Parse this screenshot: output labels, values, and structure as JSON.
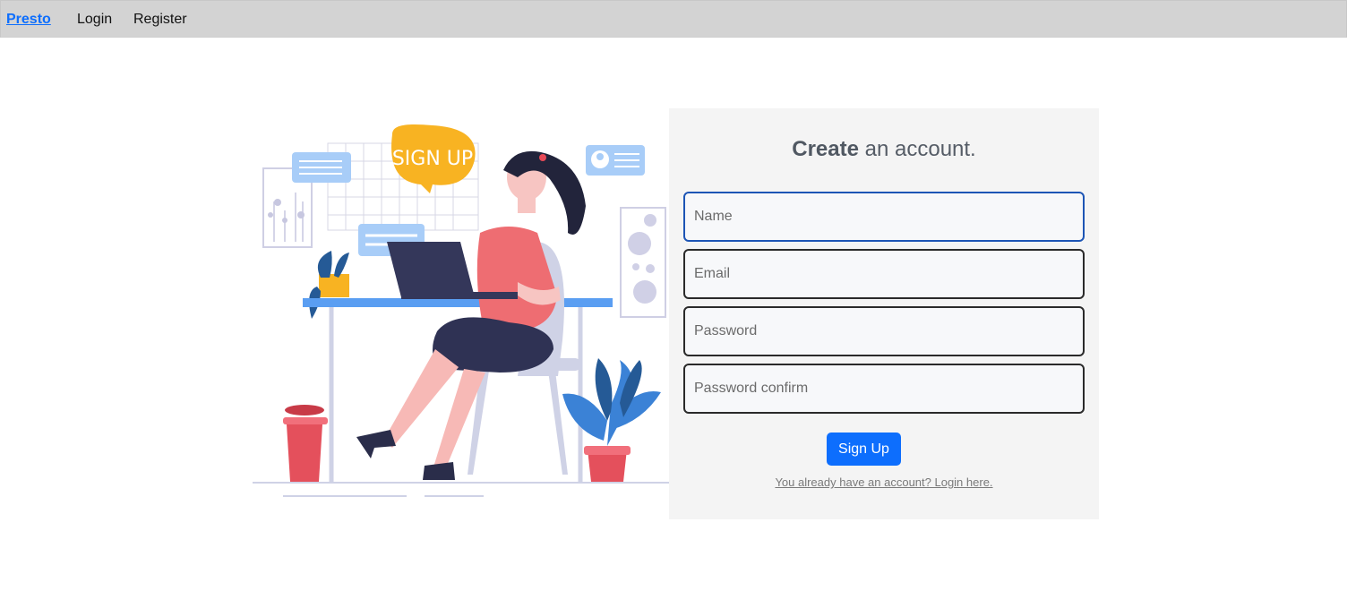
{
  "navbar": {
    "brand": "Presto",
    "login": "Login",
    "register": "Register"
  },
  "illustration": {
    "sign_text": "SIGN UP",
    "alt": "sign-up-illustration"
  },
  "form": {
    "title_strong": "Create",
    "title_rest": " an account.",
    "name_placeholder": "Name",
    "email_placeholder": "Email",
    "password_placeholder": "Password",
    "password_confirm_placeholder": "Password confirm",
    "submit_label": "Sign Up",
    "login_link": "You already have an account? Login here."
  },
  "colors": {
    "navbar": "#d3d3d3",
    "accent": "#0d6efd",
    "card": "#f4f4f4"
  }
}
